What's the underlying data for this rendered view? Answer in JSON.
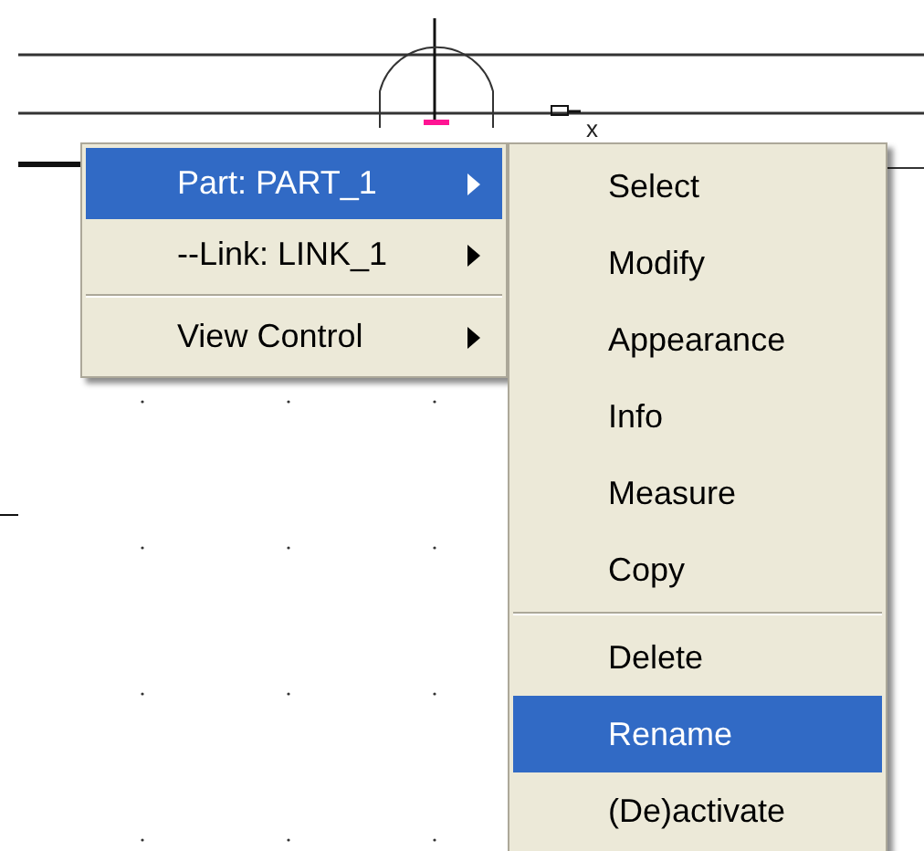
{
  "canvas": {
    "label": "x"
  },
  "context_menu": {
    "items": [
      {
        "kind": "item",
        "label": "Part: PART_1",
        "selected": true,
        "submenu": true
      },
      {
        "kind": "item",
        "label": "--Link: LINK_1",
        "selected": false,
        "submenu": true
      },
      {
        "kind": "separator"
      },
      {
        "kind": "item",
        "label": "View Control",
        "selected": false,
        "submenu": true
      }
    ]
  },
  "submenu": {
    "items": [
      {
        "kind": "item",
        "label": "Select",
        "selected": false
      },
      {
        "kind": "item",
        "label": "Modify",
        "selected": false
      },
      {
        "kind": "item",
        "label": "Appearance",
        "selected": false
      },
      {
        "kind": "item",
        "label": "Info",
        "selected": false
      },
      {
        "kind": "item",
        "label": "Measure",
        "selected": false
      },
      {
        "kind": "item",
        "label": "Copy",
        "selected": false
      },
      {
        "kind": "separator"
      },
      {
        "kind": "item",
        "label": "Delete",
        "selected": false
      },
      {
        "kind": "item",
        "label": "Rename",
        "selected": true
      },
      {
        "kind": "item",
        "label": "(De)activate",
        "selected": false
      }
    ]
  }
}
